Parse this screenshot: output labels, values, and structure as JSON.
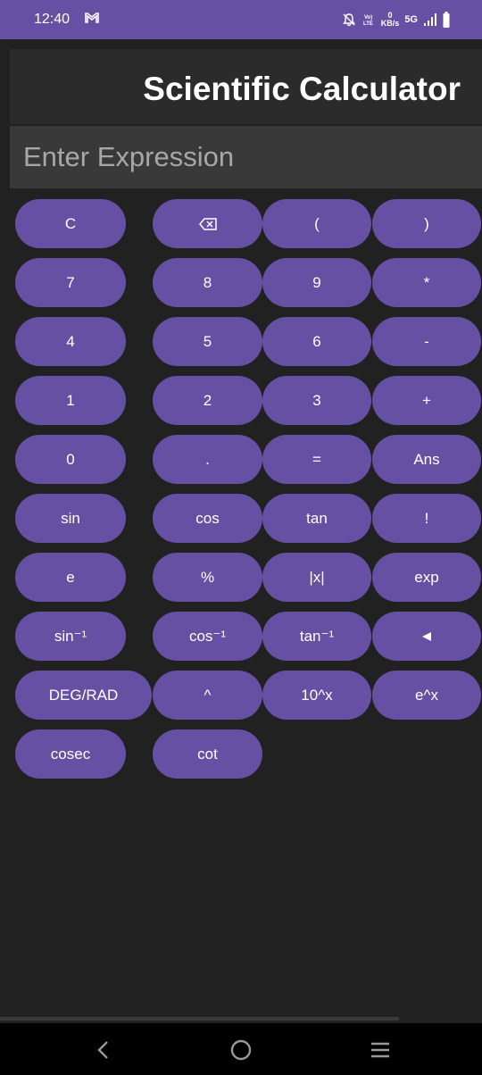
{
  "status_bar": {
    "time": "12:40",
    "network_speed_value": "0",
    "network_speed_unit": "KB/s",
    "network_type": "5G",
    "icons": [
      "gmail-icon",
      "mute-icon",
      "volte-icon",
      "signal-icon",
      "battery-icon"
    ]
  },
  "app": {
    "title": "Scientific Calculator"
  },
  "expression": {
    "value": "",
    "placeholder": "Enter Expression"
  },
  "keys": {
    "clear": "C",
    "open_paren": "(",
    "close_paren": ")",
    "seven": "7",
    "eight": "8",
    "nine": "9",
    "multiply": "*",
    "four": "4",
    "five": "5",
    "six": "6",
    "minus": "-",
    "one": "1",
    "two": "2",
    "three": "3",
    "plus": "+",
    "zero": "0",
    "dot": ".",
    "equals": "=",
    "ans": "Ans",
    "sin": "sin",
    "cos": "cos",
    "tan": "tan",
    "factorial": "!",
    "e": "e",
    "percent": "%",
    "abs": "|x|",
    "exp": "exp",
    "asin": "sin⁻¹",
    "acos": "cos⁻¹",
    "atan": "tan⁻¹",
    "deg_rad": "DEG/RAD",
    "power": "^",
    "ten_pow": "10^x",
    "e_pow": "e^x",
    "cosec": "cosec",
    "cot": "cot"
  },
  "colors": {
    "accent": "#6650a4",
    "background": "#212121",
    "title_bar": "#2b2b2b",
    "input_bg": "#393939"
  }
}
